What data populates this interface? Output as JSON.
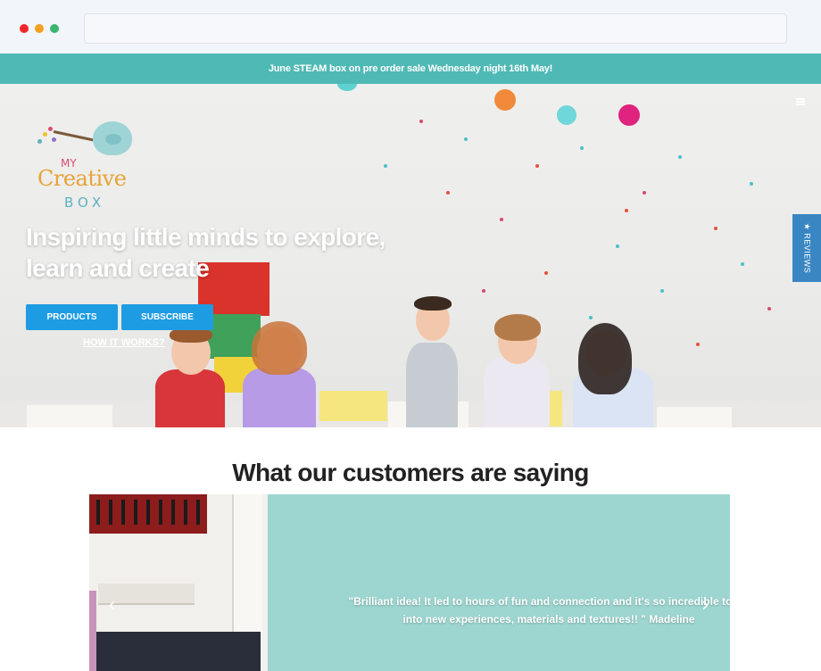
{
  "announcement": "June STEAM box on pre order sale Wednesday night 16th May!",
  "logo": {
    "my": "MY",
    "creative": "Creative",
    "box": "BOX"
  },
  "hero": {
    "title": "Inspiring little minds to explore, learn and create",
    "products_label": "PRODUCTS",
    "subscribe_label": "SUBSCRIBE",
    "how_label": "HOW IT WORKS?"
  },
  "reviews_tab": "★ REVIEWS",
  "testimonials": {
    "title": "What our customers are saying",
    "quote_line1": "\"Brilliant idea! It led to hours of fun and connection and it's so incredible to wa",
    "quote_line2": "into new experiences, materials and textures!! \" Madeline",
    "prev": "‹",
    "next": "›"
  },
  "colors": {
    "announcement_bg": "#4fb9b5",
    "button": "#1e9ce3",
    "reviews_tab": "#3a86c2",
    "testimonial_bg": "#9dd6d0"
  }
}
